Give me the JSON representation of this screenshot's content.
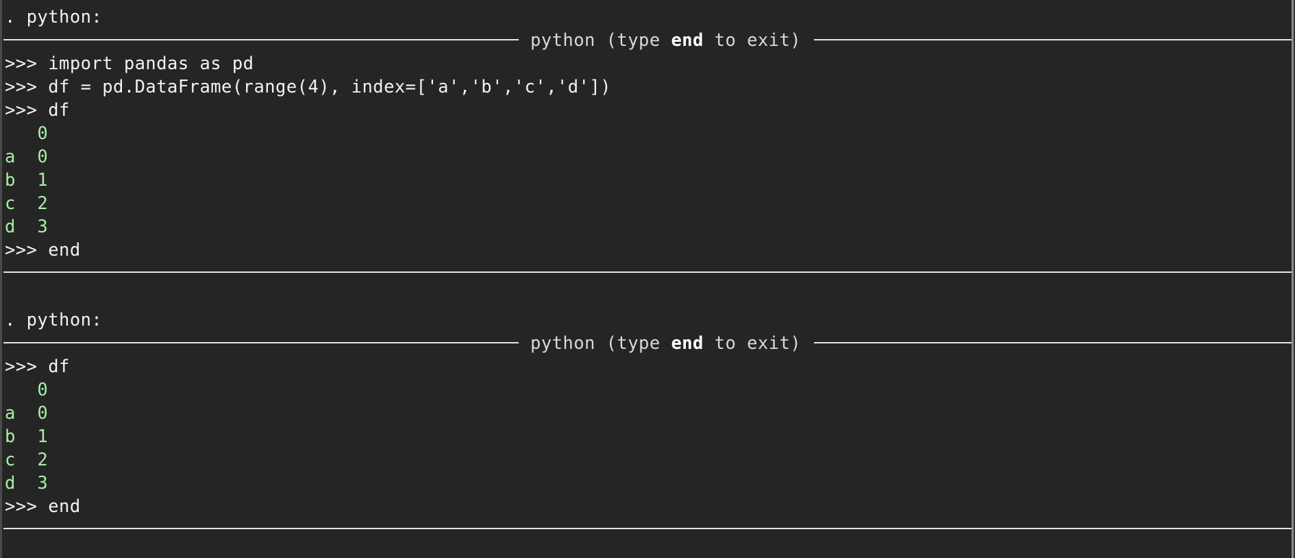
{
  "sessions": [
    {
      "header": ". python:",
      "banner": {
        "prefix": "python (type ",
        "keyword": "end",
        "suffix": " to exit)"
      },
      "lines": [
        {
          "kind": "input",
          "text": ">>> import pandas as pd"
        },
        {
          "kind": "input",
          "text": ">>> df = pd.DataFrame(range(4), index=['a','b','c','d'])"
        },
        {
          "kind": "input",
          "text": ">>> df"
        },
        {
          "kind": "output",
          "text": "   0"
        },
        {
          "kind": "output",
          "text": "a  0"
        },
        {
          "kind": "output",
          "text": "b  1"
        },
        {
          "kind": "output",
          "text": "c  2"
        },
        {
          "kind": "output",
          "text": "d  3"
        },
        {
          "kind": "input",
          "text": ">>> end"
        }
      ]
    },
    {
      "header": ". python:",
      "banner": {
        "prefix": "python (type ",
        "keyword": "end",
        "suffix": " to exit)"
      },
      "lines": [
        {
          "kind": "input",
          "text": ">>> df"
        },
        {
          "kind": "output",
          "text": "   0"
        },
        {
          "kind": "output",
          "text": "a  0"
        },
        {
          "kind": "output",
          "text": "b  1"
        },
        {
          "kind": "output",
          "text": "c  2"
        },
        {
          "kind": "output",
          "text": "d  3"
        },
        {
          "kind": "input",
          "text": ">>> end"
        }
      ]
    }
  ],
  "colors": {
    "background": "#252525",
    "input_text": "#f2f2f2",
    "output_text": "#a6eea6",
    "banner_text": "#d9d9d9",
    "rule": "#e6e6e6"
  }
}
